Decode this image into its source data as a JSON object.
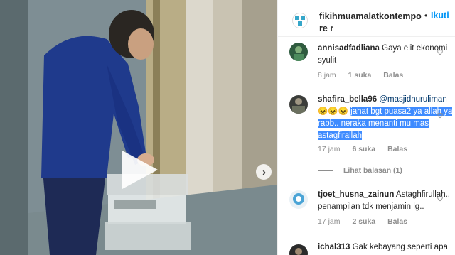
{
  "header": {
    "username": "fikihmuamalatkontempore r",
    "separator": "•",
    "follow_label": "Ikuti"
  },
  "comments": [
    {
      "username": "annisadfadliana",
      "text": "Gaya elit ekonomi syulit",
      "time": "8 jam",
      "likes": "1 suka",
      "reply_label": "Balas"
    },
    {
      "username": "shafira_bella96",
      "mention": "@masjidnuruliman",
      "emoji": "😣😣😣",
      "highlighted_text": "jahat bgt puasa2 ya allah ya rabb.. neraka menanti mu mas astagfirallah",
      "time": "17 jam",
      "likes": "6 suka",
      "reply_label": "Balas",
      "view_replies": "Lihat balasan (1)"
    },
    {
      "username": "tjoet_husna_zainun",
      "text": "Astaghfirullah.. penampilan tdk menjamin lg..",
      "time": "17 jam",
      "likes": "2 suka",
      "reply_label": "Balas"
    },
    {
      "username": "ichal313",
      "text": "Gak kebayang seperti apa"
    }
  ],
  "colors": {
    "link_blue": "#0095f6",
    "selection_blue": "#3e8bff",
    "mention": "#00376b",
    "meta_gray": "#8e8e8e"
  },
  "icons": {
    "play": "play-icon",
    "next": "chevron-right-icon",
    "heart": "heart-outline-icon"
  }
}
